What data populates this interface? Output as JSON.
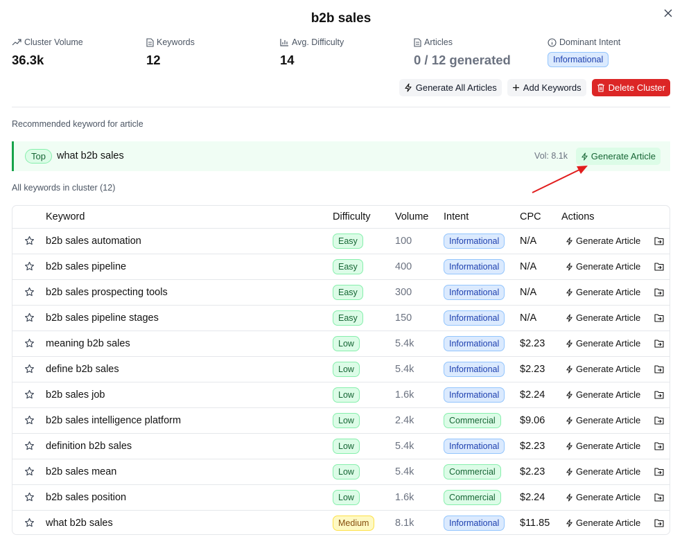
{
  "title": "b2b sales",
  "stats": {
    "cluster_volume_label": "Cluster Volume",
    "cluster_volume_value": "36.3k",
    "keywords_label": "Keywords",
    "keywords_value": "12",
    "difficulty_label": "Avg. Difficulty",
    "difficulty_value": "14",
    "articles_label": "Articles",
    "articles_value": "0 / 12 generated",
    "intent_label": "Dominant Intent",
    "intent_value": "Informational"
  },
  "toolbar": {
    "generate_all_label": "Generate All Articles",
    "add_keywords_label": "Add Keywords",
    "delete_cluster_label": "Delete Cluster"
  },
  "recommended": {
    "section_label": "Recommended keyword for article",
    "badge": "Top",
    "keyword": "what b2b sales",
    "volume": "Vol: 8.1k",
    "generate_label": "Generate Article"
  },
  "all_keywords_label": "All keywords in cluster (12)",
  "table": {
    "headers": {
      "keyword": "Keyword",
      "difficulty": "Difficulty",
      "volume": "Volume",
      "intent": "Intent",
      "cpc": "CPC",
      "actions": "Actions"
    },
    "generate_label": "Generate Article",
    "rows": [
      {
        "keyword": "b2b sales automation",
        "difficulty": "Easy",
        "volume": "100",
        "intent": "Informational",
        "cpc": "N/A"
      },
      {
        "keyword": "b2b sales pipeline",
        "difficulty": "Easy",
        "volume": "400",
        "intent": "Informational",
        "cpc": "N/A"
      },
      {
        "keyword": "b2b sales prospecting tools",
        "difficulty": "Easy",
        "volume": "300",
        "intent": "Informational",
        "cpc": "N/A"
      },
      {
        "keyword": "b2b sales pipeline stages",
        "difficulty": "Easy",
        "volume": "150",
        "intent": "Informational",
        "cpc": "N/A"
      },
      {
        "keyword": "meaning b2b sales",
        "difficulty": "Low",
        "volume": "5.4k",
        "intent": "Informational",
        "cpc": "$2.23"
      },
      {
        "keyword": "define b2b sales",
        "difficulty": "Low",
        "volume": "5.4k",
        "intent": "Informational",
        "cpc": "$2.23"
      },
      {
        "keyword": "b2b sales job",
        "difficulty": "Low",
        "volume": "1.6k",
        "intent": "Informational",
        "cpc": "$2.24"
      },
      {
        "keyword": "b2b sales intelligence platform",
        "difficulty": "Low",
        "volume": "2.4k",
        "intent": "Commercial",
        "cpc": "$9.06"
      },
      {
        "keyword": "definition b2b sales",
        "difficulty": "Low",
        "volume": "5.4k",
        "intent": "Informational",
        "cpc": "$2.23"
      },
      {
        "keyword": "b2b sales mean",
        "difficulty": "Low",
        "volume": "5.4k",
        "intent": "Commercial",
        "cpc": "$2.23"
      },
      {
        "keyword": "b2b sales position",
        "difficulty": "Low",
        "volume": "1.6k",
        "intent": "Commercial",
        "cpc": "$2.24"
      },
      {
        "keyword": "what b2b sales",
        "difficulty": "Medium",
        "volume": "8.1k",
        "intent": "Informational",
        "cpc": "$11.85"
      }
    ]
  },
  "colors": {
    "danger": "#dc2626",
    "success": "#16a34a",
    "info": "#1e40af",
    "annotation_arrow": "#e11d1d"
  }
}
